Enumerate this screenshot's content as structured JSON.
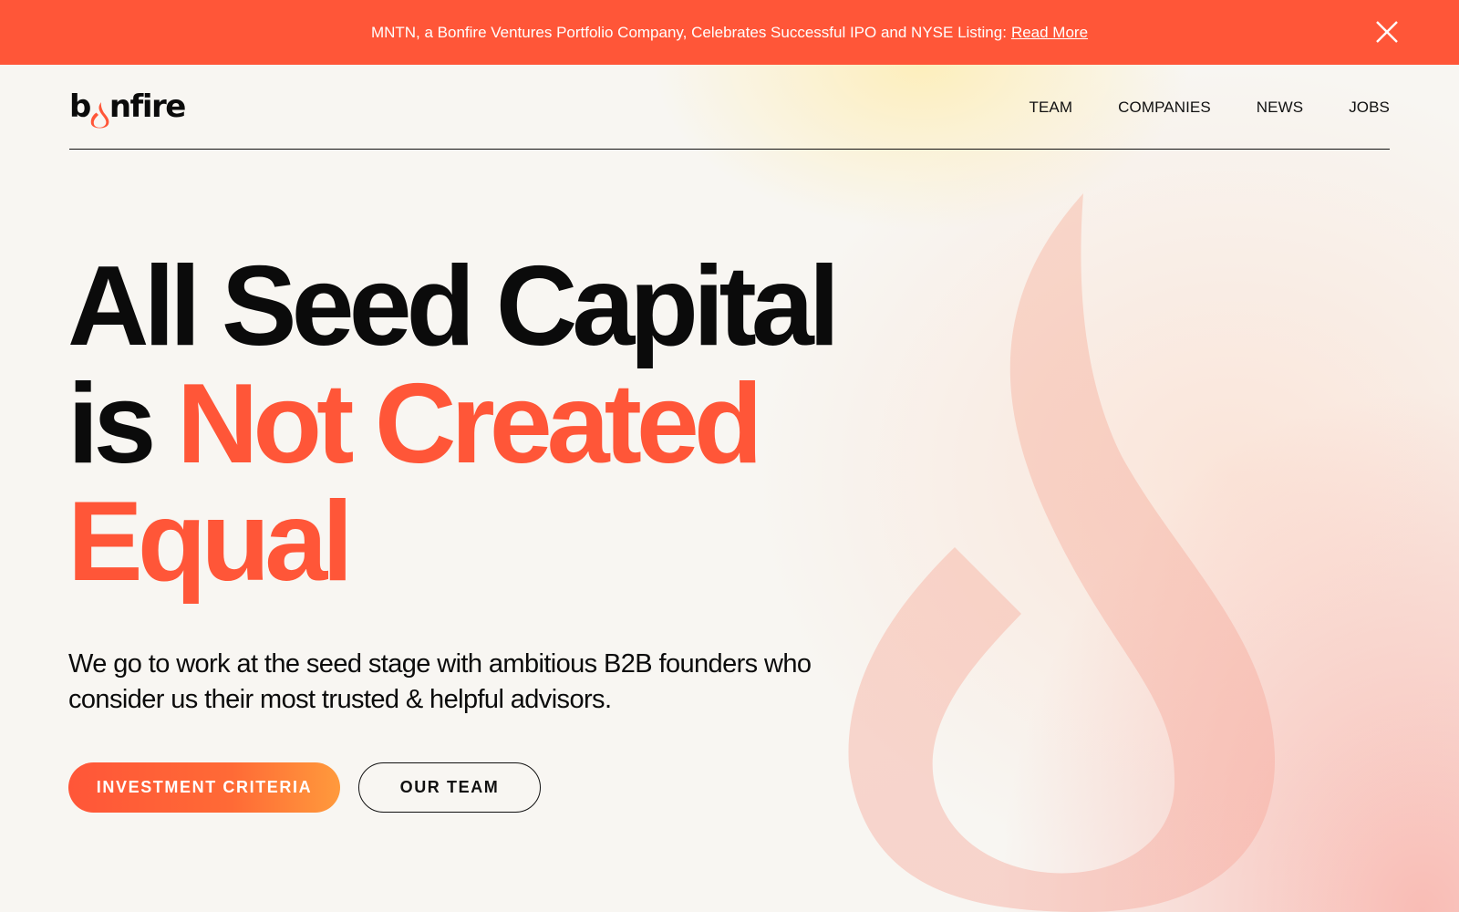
{
  "announcement": {
    "text": "MNTN, a Bonfire Ventures Portfolio Company, Celebrates Successful IPO and NYSE Listing:",
    "link_label": "Read More",
    "close_icon": "close-icon"
  },
  "header": {
    "logo_icon": "bonfire-logo",
    "nav": [
      "TEAM",
      "COMPANIES",
      "NEWS",
      "JOBS"
    ]
  },
  "hero": {
    "title_line1": "All Seed Capital",
    "title_is": "is",
    "title_accent1": "Not Created",
    "title_accent2": "Equal",
    "subtitle": "We go to work at the seed stage with ambitious B2B founders who consider us their most trusted & helpful advisors.",
    "primary_button": "INVESTMENT CRITERIA",
    "secondary_button": "OUR TEAM"
  },
  "colors": {
    "accent": "#ff5638",
    "text": "#0b0b0b",
    "background": "#f8f6f2"
  }
}
